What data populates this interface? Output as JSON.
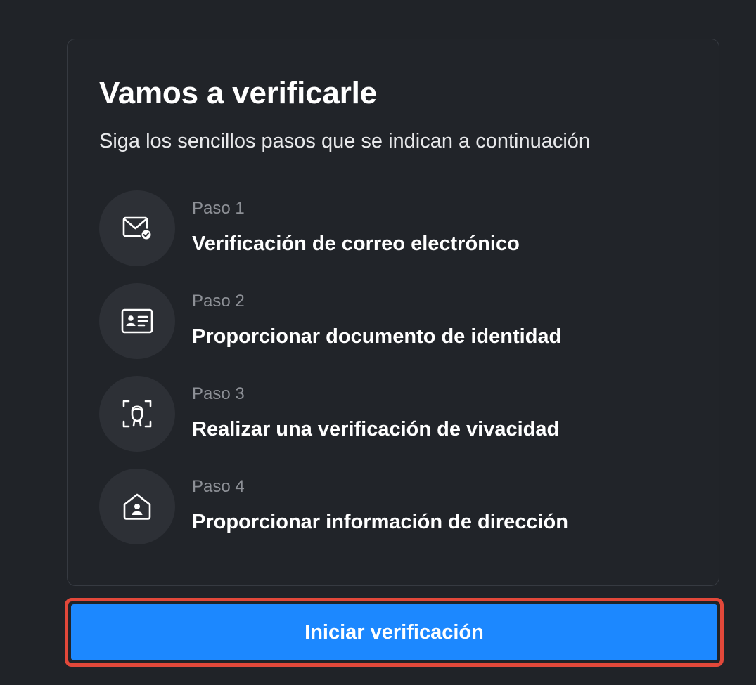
{
  "card": {
    "title": "Vamos a verificarle",
    "subtitle": "Siga los sencillos pasos que se indican a continuación"
  },
  "steps": [
    {
      "number": "Paso 1",
      "title": "Verificación de correo electrónico",
      "icon": "mail-check-icon"
    },
    {
      "number": "Paso 2",
      "title": "Proporcionar documento de identidad",
      "icon": "id-card-icon"
    },
    {
      "number": "Paso 3",
      "title": "Realizar una verificación de vivacidad",
      "icon": "face-scan-icon"
    },
    {
      "number": "Paso 4",
      "title": "Proporcionar información de dirección",
      "icon": "home-user-icon"
    }
  ],
  "start_button": {
    "label": "Iniciar verificación"
  },
  "colors": {
    "background": "#202328",
    "card_border": "#363a41",
    "icon_circle": "#2d3036",
    "accent": "#1c88ff",
    "highlight_border": "#e2483a"
  }
}
